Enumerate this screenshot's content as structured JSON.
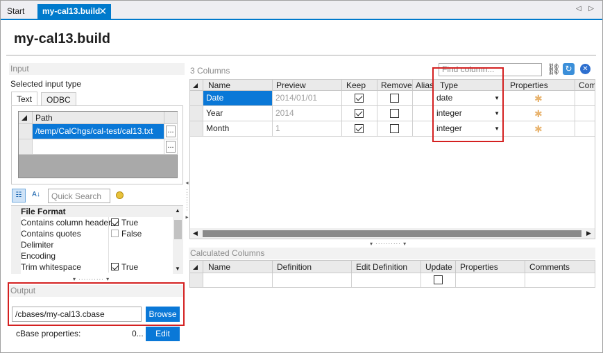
{
  "tabs": {
    "start": "Start",
    "active": "my-cal13.build",
    "close": "✕",
    "nav": "◁ ▷"
  },
  "title": "my-cal13.build",
  "input": {
    "header": "Input",
    "selected_type_label": "Selected input type",
    "tabs": [
      "Text",
      "ODBC"
    ],
    "path_header": "Path",
    "paths": [
      "/temp/CalChgs/cal-test/cal13.txt",
      ""
    ],
    "browse_small": "...",
    "quick_search_placeholder": "Quick Search",
    "props": [
      {
        "name": "File Format",
        "value": "",
        "group": true
      },
      {
        "name": "Contains column headers",
        "value": "True",
        "checked": true
      },
      {
        "name": "Contains quotes",
        "value": "False",
        "checked": false
      },
      {
        "name": "Delimiter",
        "value": ""
      },
      {
        "name": "Encoding",
        "value": ""
      },
      {
        "name": "Trim whitespace",
        "value": "True",
        "checked": true
      }
    ]
  },
  "output": {
    "header": "Output",
    "path": "/cbases/my-cal13.cbase",
    "browse": "Browse",
    "cbase_label": "cBase properties:",
    "cbase_value": "0...",
    "edit": "Edit"
  },
  "columns": {
    "count_label": "3 Columns",
    "find_placeholder": "Find column...",
    "headers": [
      "Name",
      "Preview",
      "Keep",
      "Remove",
      "Alias",
      "Type",
      "Properties",
      "Comm"
    ],
    "rows": [
      {
        "name": "Date",
        "preview": "2014/01/01",
        "keep": true,
        "remove": false,
        "type": "date"
      },
      {
        "name": "Year",
        "preview": "2014",
        "keep": true,
        "remove": false,
        "type": "integer"
      },
      {
        "name": "Month",
        "preview": "1",
        "keep": true,
        "remove": false,
        "type": "integer"
      }
    ]
  },
  "calculated": {
    "header": "Calculated Columns",
    "headers": [
      "Name",
      "Definition",
      "Edit Definition",
      "Update",
      "Properties",
      "Comments"
    ]
  },
  "colors": {
    "accent": "#007acc",
    "selection": "#0a78d7",
    "highlight": "#d42020"
  }
}
